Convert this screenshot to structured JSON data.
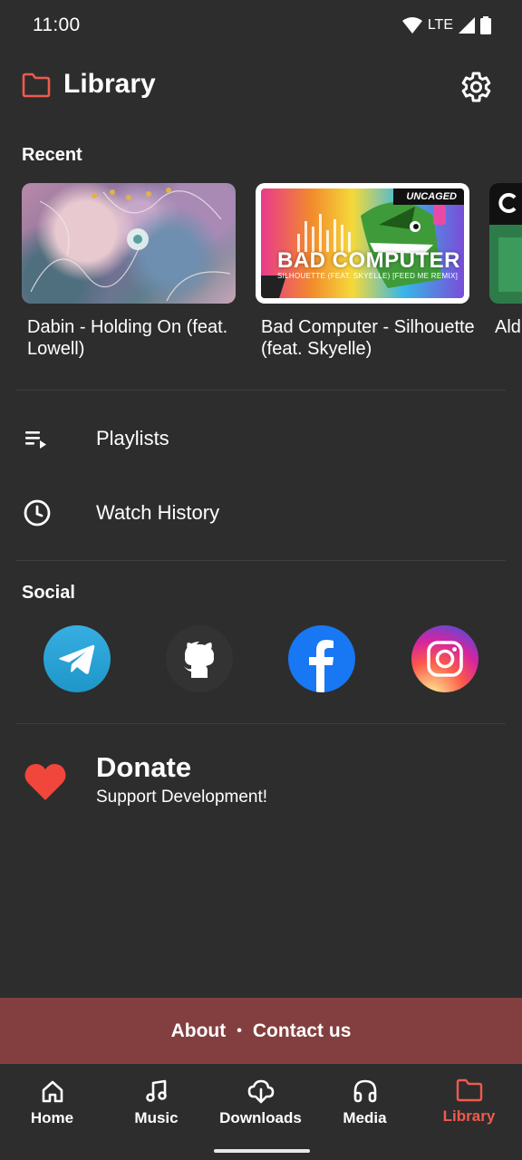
{
  "status_bar": {
    "time": "11:00",
    "network": "LTE"
  },
  "header": {
    "title": "Library"
  },
  "recent": {
    "section_title": "Recent",
    "items": [
      {
        "title": "Dabin - Holding On (feat. Lowell)"
      },
      {
        "title": "Bad Computer - Silhouette (feat. Skyelle)",
        "thumb_text": "BAD COMPUTER",
        "thumb_subtext": "SILHOUETTE (FEAT. SKYELLE) [FEED ME REMIX]",
        "thumb_badge": "UNCAGED"
      },
      {
        "title": "Ald - Ma"
      }
    ]
  },
  "menu": [
    {
      "label": "Playlists",
      "icon": "playlist-icon"
    },
    {
      "label": "Watch History",
      "icon": "history-clock-icon"
    }
  ],
  "social": {
    "section_title": "Social",
    "items": [
      {
        "name": "telegram",
        "color": "#2aa3dd"
      },
      {
        "name": "github",
        "color": "#333333"
      },
      {
        "name": "facebook",
        "color": "#1877f2"
      },
      {
        "name": "instagram",
        "color": "#d6249f"
      }
    ]
  },
  "donate": {
    "title": "Donate",
    "subtitle": "Support Development!"
  },
  "footer": {
    "about": "About",
    "separator": "•",
    "contact": "Contact us"
  },
  "bottom_nav": [
    {
      "label": "Home",
      "icon": "home-icon",
      "active": false
    },
    {
      "label": "Music",
      "icon": "music-note-icon",
      "active": false
    },
    {
      "label": "Downloads",
      "icon": "cloud-download-icon",
      "active": false
    },
    {
      "label": "Media",
      "icon": "headphones-icon",
      "active": false
    },
    {
      "label": "Library",
      "icon": "folder-icon",
      "active": true
    }
  ],
  "colors": {
    "accent": "#ef5a4e",
    "background": "#2d2d2d",
    "footer_band": "#833f3f",
    "heart": "#f0463c"
  }
}
